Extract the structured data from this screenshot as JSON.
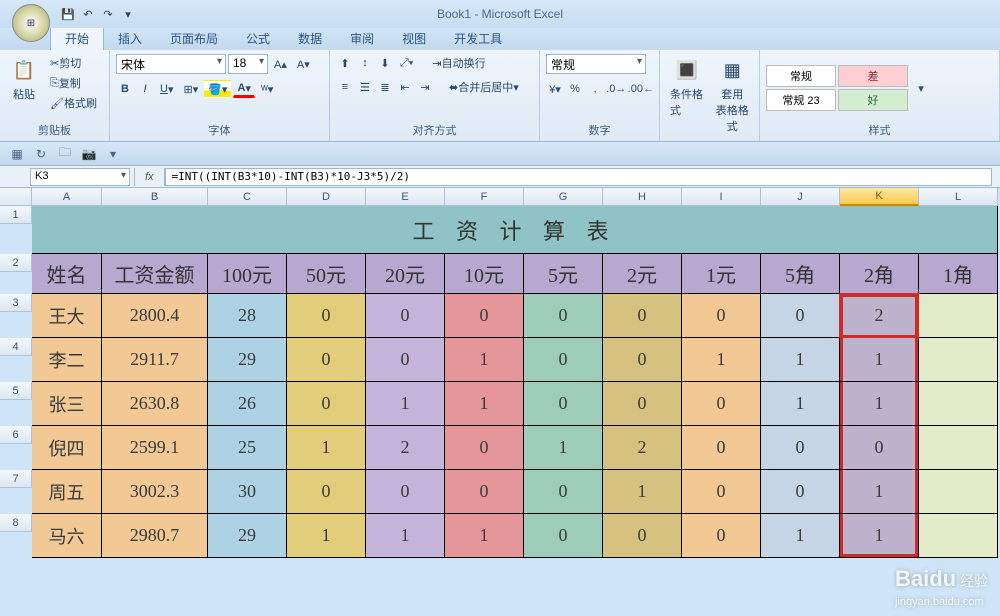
{
  "title": "Book1 - Microsoft Excel",
  "tabs": [
    "开始",
    "插入",
    "页面布局",
    "公式",
    "数据",
    "审阅",
    "视图",
    "开发工具"
  ],
  "activeTabIndex": 0,
  "clipboard": {
    "paste": "粘贴",
    "cut": "剪切",
    "copy": "复制",
    "painter": "格式刷",
    "group": "剪贴板"
  },
  "font": {
    "family": "宋体",
    "size": "18",
    "group": "字体"
  },
  "align": {
    "wrap": "自动换行",
    "merge": "合并后居中",
    "group": "对齐方式"
  },
  "number": {
    "format": "常规",
    "group": "数字"
  },
  "styles": {
    "condfmt": "条件格式",
    "tablefmt": "套用\n表格格式",
    "normal": "常规",
    "normal23": "常规 23",
    "bad": "差",
    "good": "好",
    "group": "样式"
  },
  "nameBox": "K3",
  "formula": "=INT((INT(B3*10)-INT(B3)*10-J3*5)/2)",
  "columns": [
    "A",
    "B",
    "C",
    "D",
    "E",
    "F",
    "G",
    "H",
    "I",
    "J",
    "K",
    "L"
  ],
  "selectedCol": "K",
  "rowHeaders": [
    "1",
    "2",
    "3",
    "4",
    "5",
    "6",
    "7",
    "8"
  ],
  "sheetTitle": "工 资 计 算 表",
  "headers": [
    "姓名",
    "工资金额",
    "100元",
    "50元",
    "20元",
    "10元",
    "5元",
    "2元",
    "1元",
    "5角",
    "2角",
    "1角"
  ],
  "data": [
    [
      "王大",
      "2800.4",
      "28",
      "0",
      "0",
      "0",
      "0",
      "0",
      "0",
      "0",
      "2",
      ""
    ],
    [
      "李二",
      "2911.7",
      "29",
      "0",
      "0",
      "1",
      "0",
      "0",
      "1",
      "1",
      "1",
      ""
    ],
    [
      "张三",
      "2630.8",
      "26",
      "0",
      "1",
      "1",
      "0",
      "0",
      "0",
      "1",
      "1",
      ""
    ],
    [
      "倪四",
      "2599.1",
      "25",
      "1",
      "2",
      "0",
      "1",
      "2",
      "0",
      "0",
      "0",
      ""
    ],
    [
      "周五",
      "3002.3",
      "30",
      "0",
      "0",
      "0",
      "0",
      "1",
      "0",
      "0",
      "1",
      ""
    ],
    [
      "马六",
      "2980.7",
      "29",
      "1",
      "1",
      "1",
      "0",
      "0",
      "0",
      "1",
      "1",
      ""
    ]
  ],
  "chart_data": {
    "type": "table",
    "title": "工 资 计 算 表",
    "columns": [
      "姓名",
      "工资金额",
      "100元",
      "50元",
      "20元",
      "10元",
      "5元",
      "2元",
      "1元",
      "5角",
      "2角",
      "1角"
    ],
    "rows": [
      {
        "姓名": "王大",
        "工资金额": 2800.4,
        "100元": 28,
        "50元": 0,
        "20元": 0,
        "10元": 0,
        "5元": 0,
        "2元": 0,
        "1元": 0,
        "5角": 0,
        "2角": 2,
        "1角": null
      },
      {
        "姓名": "李二",
        "工资金额": 2911.7,
        "100元": 29,
        "50元": 0,
        "20元": 0,
        "10元": 1,
        "5元": 0,
        "2元": 0,
        "1元": 1,
        "5角": 1,
        "2角": 1,
        "1角": null
      },
      {
        "姓名": "张三",
        "工资金额": 2630.8,
        "100元": 26,
        "50元": 0,
        "20元": 1,
        "10元": 1,
        "5元": 0,
        "2元": 0,
        "1元": 0,
        "5角": 1,
        "2角": 1,
        "1角": null
      },
      {
        "姓名": "倪四",
        "工资金额": 2599.1,
        "100元": 25,
        "50元": 1,
        "20元": 2,
        "10元": 0,
        "5元": 1,
        "2元": 2,
        "1元": 0,
        "5角": 0,
        "2角": 0,
        "1角": null
      },
      {
        "姓名": "周五",
        "工资金额": 3002.3,
        "100元": 30,
        "50元": 0,
        "20元": 0,
        "10元": 0,
        "5元": 0,
        "2元": 1,
        "1元": 0,
        "5角": 0,
        "2角": 1,
        "1角": null
      },
      {
        "姓名": "马六",
        "工资金额": 2980.7,
        "100元": 29,
        "50元": 1,
        "20元": 1,
        "10元": 1,
        "5元": 0,
        "2元": 0,
        "1元": 0,
        "5角": 1,
        "2角": 1,
        "1角": null
      }
    ]
  },
  "watermark": {
    "brand": "Baidu",
    "sub": "经验",
    "url": "jingyan.baidu.com"
  }
}
